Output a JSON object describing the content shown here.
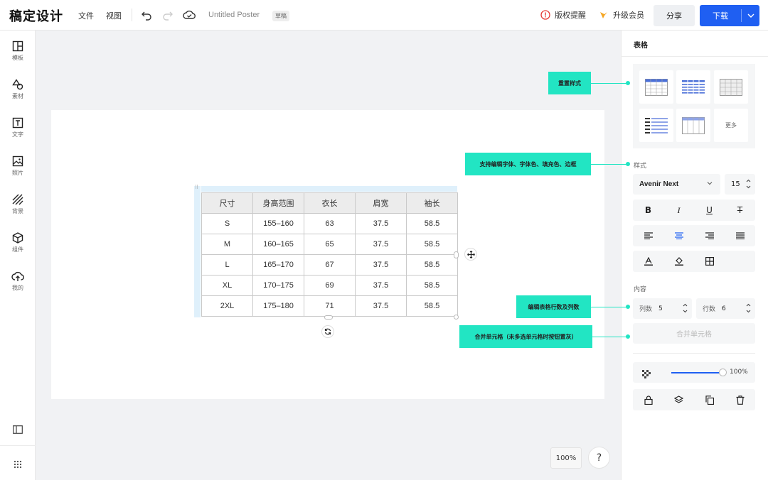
{
  "app": {
    "logo": "稿定设计",
    "menu": [
      "文件",
      "视图"
    ],
    "doc_title": "Untitled Poster",
    "draft_badge": "草稿"
  },
  "header": {
    "copyright_label": "版权提醒",
    "upgrade_label": "升级会员",
    "share_label": "分享",
    "download_label": "下载"
  },
  "sidebar": {
    "items": [
      {
        "label": "模板",
        "icon": "template-icon"
      },
      {
        "label": "素材",
        "icon": "shapes-icon"
      },
      {
        "label": "文字",
        "icon": "text-icon"
      },
      {
        "label": "照片",
        "icon": "photo-icon"
      },
      {
        "label": "背景",
        "icon": "background-icon"
      },
      {
        "label": "组件",
        "icon": "component-icon"
      },
      {
        "label": "我的",
        "icon": "upload-cloud-icon"
      }
    ]
  },
  "table": {
    "headers": [
      "尺寸",
      "身高范围",
      "衣长",
      "肩宽",
      "袖长"
    ],
    "rows": [
      [
        "S",
        "155–160",
        "63",
        "37.5",
        "58.5"
      ],
      [
        "M",
        "160–165",
        "65",
        "37.5",
        "58.5"
      ],
      [
        "L",
        "165–170",
        "67",
        "37.5",
        "58.5"
      ],
      [
        "XL",
        "170–175",
        "69",
        "37.5",
        "58.5"
      ],
      [
        "2XL",
        "175–180",
        "71",
        "37.5",
        "58.5"
      ]
    ]
  },
  "canvas": {
    "zoom": "100%",
    "help": "?"
  },
  "panel": {
    "title": "表格",
    "more_label": "更多",
    "style_label": "样式",
    "font_name": "Avenir Next",
    "font_size": "15",
    "content_label": "内容",
    "cols_label": "列数",
    "cols_value": "5",
    "rows_label": "行数",
    "rows_value": "6",
    "merge_label": "合并单元格",
    "opacity": "100%"
  },
  "annotations": {
    "reset_style": "重置样式",
    "edit_font": "支持编辑字体、字体色、填充色、边框",
    "edit_rows_cols": "编辑表格行数及列数",
    "merge_cells": "合并单元格（未多选单元格时按钮置灰）"
  },
  "colors": {
    "accent": "#1f5ff2",
    "annotation": "#22e5c3",
    "warning": "#e53935",
    "vip": "#f5a623"
  }
}
